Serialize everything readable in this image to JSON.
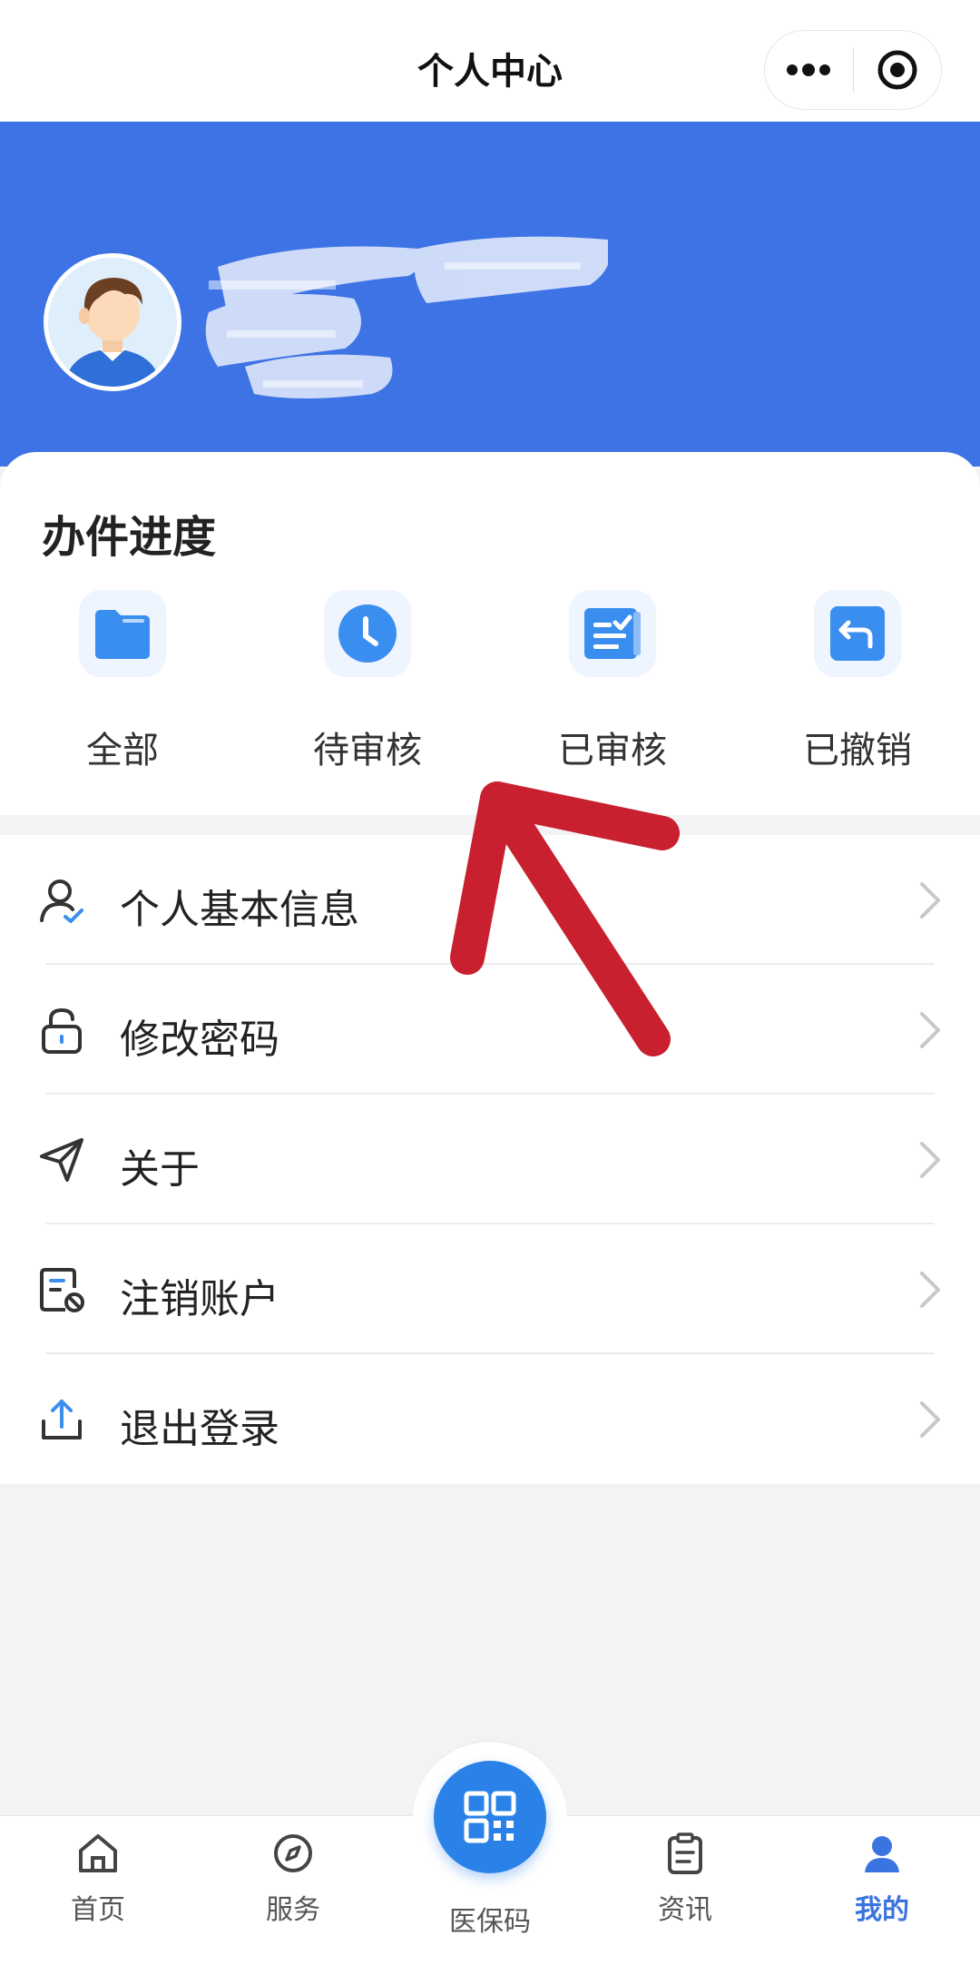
{
  "header": {
    "title": "个人中心"
  },
  "progress": {
    "heading": "办件进度",
    "items": [
      {
        "label": "全部",
        "icon": "folder-icon"
      },
      {
        "label": "待审核",
        "icon": "clock-icon"
      },
      {
        "label": "已审核",
        "icon": "reviewed-list-icon"
      },
      {
        "label": "已撤销",
        "icon": "undo-icon"
      }
    ]
  },
  "menu": {
    "items": [
      {
        "label": "个人基本信息",
        "icon": "user-check-icon"
      },
      {
        "label": "修改密码",
        "icon": "lock-icon"
      },
      {
        "label": "关于",
        "icon": "send-icon"
      },
      {
        "label": "注销账户",
        "icon": "cancel-account-icon"
      },
      {
        "label": "退出登录",
        "icon": "upload-icon"
      }
    ]
  },
  "tabbar": {
    "items": [
      {
        "label": "首页",
        "icon": "home-icon"
      },
      {
        "label": "服务",
        "icon": "compass-icon"
      },
      {
        "label": "医保码",
        "icon": "qr-code-icon"
      },
      {
        "label": "资讯",
        "icon": "clipboard-icon"
      },
      {
        "label": "我的",
        "icon": "user-icon"
      }
    ],
    "active": "我的"
  },
  "colors": {
    "accent": "#3d73e4",
    "tab_active": "#3a74e0",
    "icon_blue": "#3a8ef0",
    "annotation_arrow": "#c8202f"
  }
}
